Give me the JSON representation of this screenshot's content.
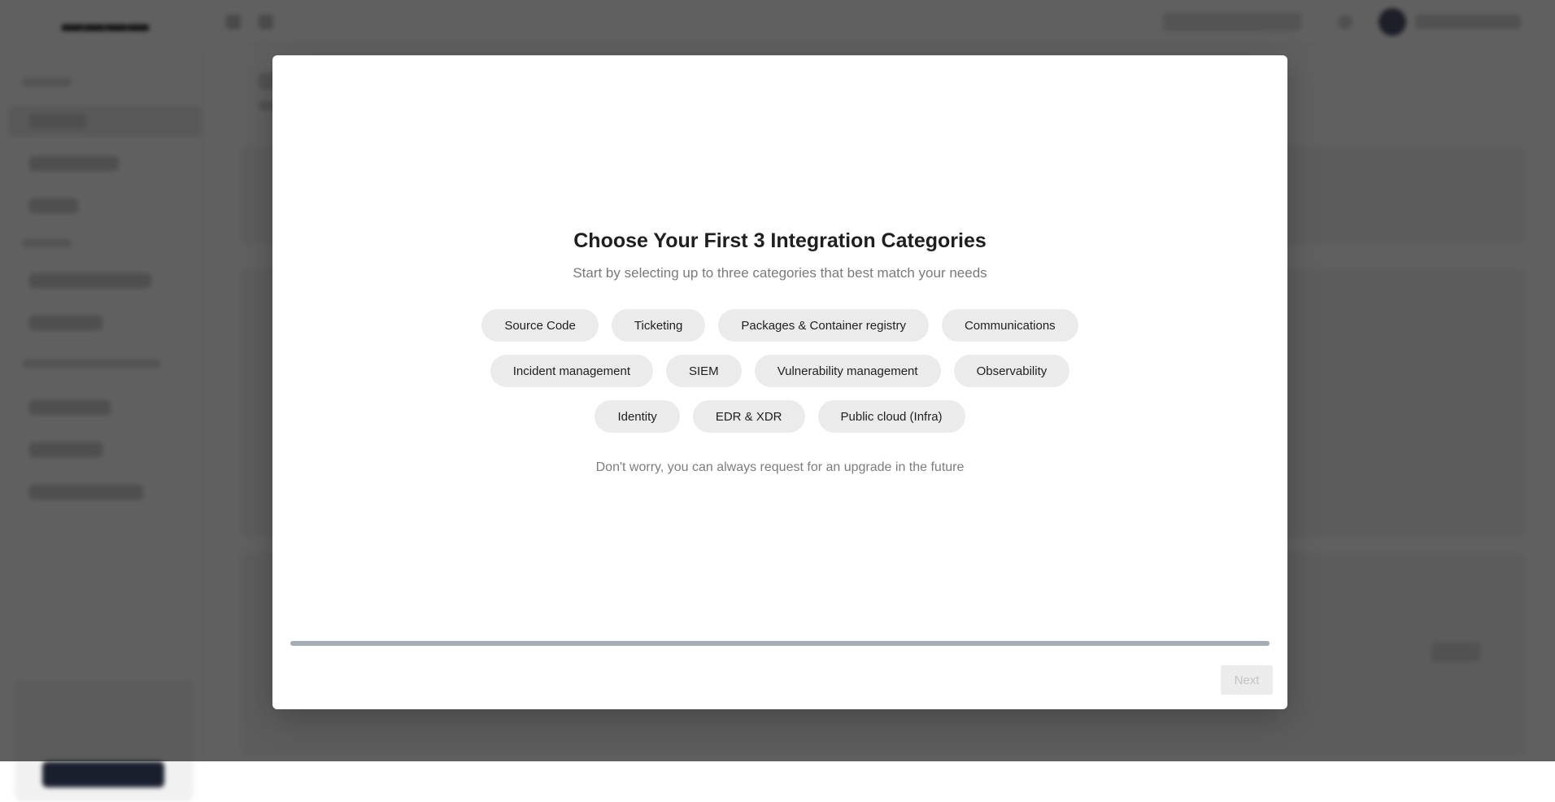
{
  "modal": {
    "title": "Choose Your First 3 Integration Categories",
    "subtitle": "Start by selecting up to three categories that best match your needs",
    "note": "Don't worry, you can always request for an upgrade in the future",
    "progress_fraction": 1.0,
    "next_label": "Next"
  },
  "categories": {
    "row1": [
      "Source Code",
      "Ticketing",
      "Packages & Container registry",
      "Communications"
    ],
    "row2": [
      "Incident management",
      "SIEM",
      "Vulnerability management",
      "Observability"
    ],
    "row3": [
      "Identity",
      "EDR & XDR",
      "Public cloud (Infra)"
    ]
  }
}
